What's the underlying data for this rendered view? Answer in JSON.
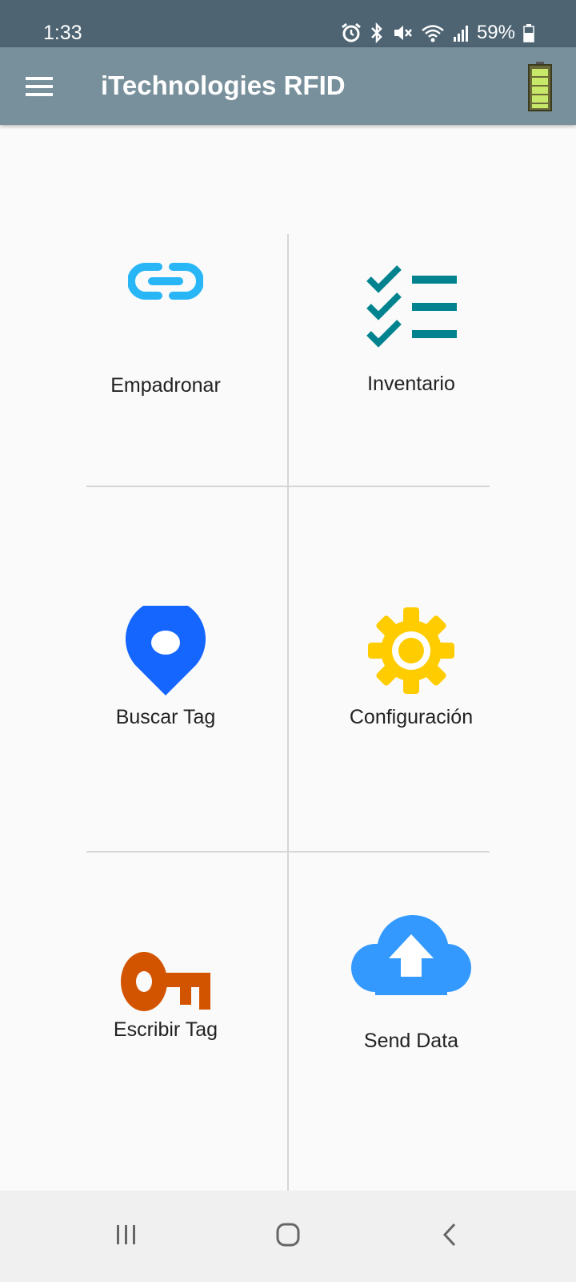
{
  "status_bar": {
    "time": "1:33",
    "battery_percent": "59%",
    "icons": [
      "alarm-icon",
      "bluetooth-icon",
      "mute-icon",
      "wifi-icon",
      "signal-icon",
      "phone-battery-icon"
    ]
  },
  "app_bar": {
    "title": "iTechnologies RFID",
    "menu_icon": "hamburger-menu-icon",
    "reader_battery_icon": "reader-battery-icon",
    "background_color": "#78909c"
  },
  "menu": {
    "items": [
      {
        "label": "Empadronar",
        "icon": "link-icon",
        "color": "#29b6f6"
      },
      {
        "label": "Inventario",
        "icon": "checklist-icon",
        "color": "#00838f"
      },
      {
        "label": "Buscar Tag",
        "icon": "location-pin-icon",
        "color": "#1565ff"
      },
      {
        "label": "Configuración",
        "icon": "gear-icon",
        "color": "#ffcc00"
      },
      {
        "label": "Escribir Tag",
        "icon": "key-icon",
        "color": "#d35400"
      },
      {
        "label": "Send Data",
        "icon": "cloud-upload-icon",
        "color": "#3399ff"
      }
    ]
  },
  "nav_bar": {
    "buttons": [
      "recent-apps-icon",
      "home-icon",
      "back-icon"
    ]
  }
}
